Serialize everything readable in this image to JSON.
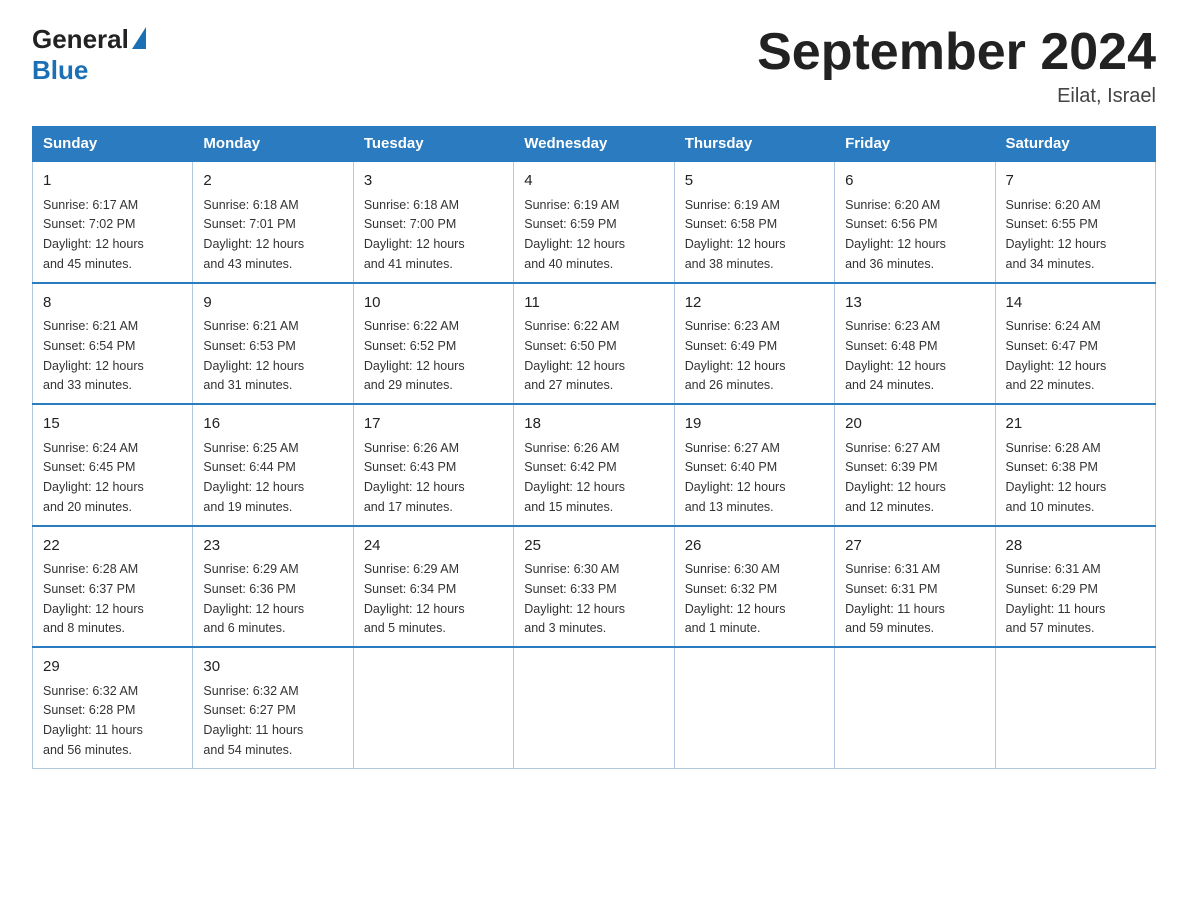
{
  "logo": {
    "text_general": "General",
    "triangle": "▶",
    "text_blue": "Blue"
  },
  "title": "September 2024",
  "subtitle": "Eilat, Israel",
  "days_of_week": [
    "Sunday",
    "Monday",
    "Tuesday",
    "Wednesday",
    "Thursday",
    "Friday",
    "Saturday"
  ],
  "weeks": [
    [
      {
        "day": 1,
        "sunrise": "6:17 AM",
        "sunset": "7:02 PM",
        "daylight": "12 hours and 45 minutes."
      },
      {
        "day": 2,
        "sunrise": "6:18 AM",
        "sunset": "7:01 PM",
        "daylight": "12 hours and 43 minutes."
      },
      {
        "day": 3,
        "sunrise": "6:18 AM",
        "sunset": "7:00 PM",
        "daylight": "12 hours and 41 minutes."
      },
      {
        "day": 4,
        "sunrise": "6:19 AM",
        "sunset": "6:59 PM",
        "daylight": "12 hours and 40 minutes."
      },
      {
        "day": 5,
        "sunrise": "6:19 AM",
        "sunset": "6:58 PM",
        "daylight": "12 hours and 38 minutes."
      },
      {
        "day": 6,
        "sunrise": "6:20 AM",
        "sunset": "6:56 PM",
        "daylight": "12 hours and 36 minutes."
      },
      {
        "day": 7,
        "sunrise": "6:20 AM",
        "sunset": "6:55 PM",
        "daylight": "12 hours and 34 minutes."
      }
    ],
    [
      {
        "day": 8,
        "sunrise": "6:21 AM",
        "sunset": "6:54 PM",
        "daylight": "12 hours and 33 minutes."
      },
      {
        "day": 9,
        "sunrise": "6:21 AM",
        "sunset": "6:53 PM",
        "daylight": "12 hours and 31 minutes."
      },
      {
        "day": 10,
        "sunrise": "6:22 AM",
        "sunset": "6:52 PM",
        "daylight": "12 hours and 29 minutes."
      },
      {
        "day": 11,
        "sunrise": "6:22 AM",
        "sunset": "6:50 PM",
        "daylight": "12 hours and 27 minutes."
      },
      {
        "day": 12,
        "sunrise": "6:23 AM",
        "sunset": "6:49 PM",
        "daylight": "12 hours and 26 minutes."
      },
      {
        "day": 13,
        "sunrise": "6:23 AM",
        "sunset": "6:48 PM",
        "daylight": "12 hours and 24 minutes."
      },
      {
        "day": 14,
        "sunrise": "6:24 AM",
        "sunset": "6:47 PM",
        "daylight": "12 hours and 22 minutes."
      }
    ],
    [
      {
        "day": 15,
        "sunrise": "6:24 AM",
        "sunset": "6:45 PM",
        "daylight": "12 hours and 20 minutes."
      },
      {
        "day": 16,
        "sunrise": "6:25 AM",
        "sunset": "6:44 PM",
        "daylight": "12 hours and 19 minutes."
      },
      {
        "day": 17,
        "sunrise": "6:26 AM",
        "sunset": "6:43 PM",
        "daylight": "12 hours and 17 minutes."
      },
      {
        "day": 18,
        "sunrise": "6:26 AM",
        "sunset": "6:42 PM",
        "daylight": "12 hours and 15 minutes."
      },
      {
        "day": 19,
        "sunrise": "6:27 AM",
        "sunset": "6:40 PM",
        "daylight": "12 hours and 13 minutes."
      },
      {
        "day": 20,
        "sunrise": "6:27 AM",
        "sunset": "6:39 PM",
        "daylight": "12 hours and 12 minutes."
      },
      {
        "day": 21,
        "sunrise": "6:28 AM",
        "sunset": "6:38 PM",
        "daylight": "12 hours and 10 minutes."
      }
    ],
    [
      {
        "day": 22,
        "sunrise": "6:28 AM",
        "sunset": "6:37 PM",
        "daylight": "12 hours and 8 minutes."
      },
      {
        "day": 23,
        "sunrise": "6:29 AM",
        "sunset": "6:36 PM",
        "daylight": "12 hours and 6 minutes."
      },
      {
        "day": 24,
        "sunrise": "6:29 AM",
        "sunset": "6:34 PM",
        "daylight": "12 hours and 5 minutes."
      },
      {
        "day": 25,
        "sunrise": "6:30 AM",
        "sunset": "6:33 PM",
        "daylight": "12 hours and 3 minutes."
      },
      {
        "day": 26,
        "sunrise": "6:30 AM",
        "sunset": "6:32 PM",
        "daylight": "12 hours and 1 minute."
      },
      {
        "day": 27,
        "sunrise": "6:31 AM",
        "sunset": "6:31 PM",
        "daylight": "11 hours and 59 minutes."
      },
      {
        "day": 28,
        "sunrise": "6:31 AM",
        "sunset": "6:29 PM",
        "daylight": "11 hours and 57 minutes."
      }
    ],
    [
      {
        "day": 29,
        "sunrise": "6:32 AM",
        "sunset": "6:28 PM",
        "daylight": "11 hours and 56 minutes."
      },
      {
        "day": 30,
        "sunrise": "6:32 AM",
        "sunset": "6:27 PM",
        "daylight": "11 hours and 54 minutes."
      },
      null,
      null,
      null,
      null,
      null
    ]
  ],
  "labels": {
    "sunrise": "Sunrise:",
    "sunset": "Sunset:",
    "daylight": "Daylight:"
  }
}
